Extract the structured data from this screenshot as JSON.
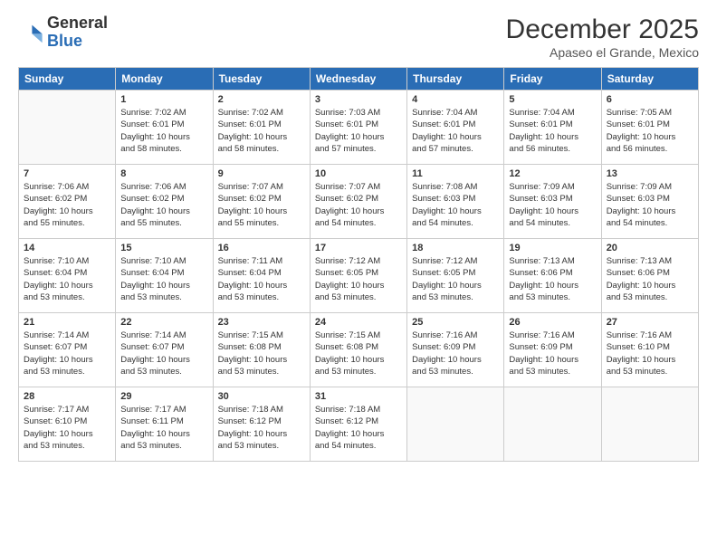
{
  "header": {
    "logo_general": "General",
    "logo_blue": "Blue",
    "month": "December 2025",
    "location": "Apaseo el Grande, Mexico"
  },
  "days_of_week": [
    "Sunday",
    "Monday",
    "Tuesday",
    "Wednesday",
    "Thursday",
    "Friday",
    "Saturday"
  ],
  "weeks": [
    [
      {
        "day": "",
        "info": ""
      },
      {
        "day": "1",
        "info": "Sunrise: 7:02 AM\nSunset: 6:01 PM\nDaylight: 10 hours\nand 58 minutes."
      },
      {
        "day": "2",
        "info": "Sunrise: 7:02 AM\nSunset: 6:01 PM\nDaylight: 10 hours\nand 58 minutes."
      },
      {
        "day": "3",
        "info": "Sunrise: 7:03 AM\nSunset: 6:01 PM\nDaylight: 10 hours\nand 57 minutes."
      },
      {
        "day": "4",
        "info": "Sunrise: 7:04 AM\nSunset: 6:01 PM\nDaylight: 10 hours\nand 57 minutes."
      },
      {
        "day": "5",
        "info": "Sunrise: 7:04 AM\nSunset: 6:01 PM\nDaylight: 10 hours\nand 56 minutes."
      },
      {
        "day": "6",
        "info": "Sunrise: 7:05 AM\nSunset: 6:01 PM\nDaylight: 10 hours\nand 56 minutes."
      }
    ],
    [
      {
        "day": "7",
        "info": "Sunrise: 7:06 AM\nSunset: 6:02 PM\nDaylight: 10 hours\nand 55 minutes."
      },
      {
        "day": "8",
        "info": "Sunrise: 7:06 AM\nSunset: 6:02 PM\nDaylight: 10 hours\nand 55 minutes."
      },
      {
        "day": "9",
        "info": "Sunrise: 7:07 AM\nSunset: 6:02 PM\nDaylight: 10 hours\nand 55 minutes."
      },
      {
        "day": "10",
        "info": "Sunrise: 7:07 AM\nSunset: 6:02 PM\nDaylight: 10 hours\nand 54 minutes."
      },
      {
        "day": "11",
        "info": "Sunrise: 7:08 AM\nSunset: 6:03 PM\nDaylight: 10 hours\nand 54 minutes."
      },
      {
        "day": "12",
        "info": "Sunrise: 7:09 AM\nSunset: 6:03 PM\nDaylight: 10 hours\nand 54 minutes."
      },
      {
        "day": "13",
        "info": "Sunrise: 7:09 AM\nSunset: 6:03 PM\nDaylight: 10 hours\nand 54 minutes."
      }
    ],
    [
      {
        "day": "14",
        "info": "Sunrise: 7:10 AM\nSunset: 6:04 PM\nDaylight: 10 hours\nand 53 minutes."
      },
      {
        "day": "15",
        "info": "Sunrise: 7:10 AM\nSunset: 6:04 PM\nDaylight: 10 hours\nand 53 minutes."
      },
      {
        "day": "16",
        "info": "Sunrise: 7:11 AM\nSunset: 6:04 PM\nDaylight: 10 hours\nand 53 minutes."
      },
      {
        "day": "17",
        "info": "Sunrise: 7:12 AM\nSunset: 6:05 PM\nDaylight: 10 hours\nand 53 minutes."
      },
      {
        "day": "18",
        "info": "Sunrise: 7:12 AM\nSunset: 6:05 PM\nDaylight: 10 hours\nand 53 minutes."
      },
      {
        "day": "19",
        "info": "Sunrise: 7:13 AM\nSunset: 6:06 PM\nDaylight: 10 hours\nand 53 minutes."
      },
      {
        "day": "20",
        "info": "Sunrise: 7:13 AM\nSunset: 6:06 PM\nDaylight: 10 hours\nand 53 minutes."
      }
    ],
    [
      {
        "day": "21",
        "info": "Sunrise: 7:14 AM\nSunset: 6:07 PM\nDaylight: 10 hours\nand 53 minutes."
      },
      {
        "day": "22",
        "info": "Sunrise: 7:14 AM\nSunset: 6:07 PM\nDaylight: 10 hours\nand 53 minutes."
      },
      {
        "day": "23",
        "info": "Sunrise: 7:15 AM\nSunset: 6:08 PM\nDaylight: 10 hours\nand 53 minutes."
      },
      {
        "day": "24",
        "info": "Sunrise: 7:15 AM\nSunset: 6:08 PM\nDaylight: 10 hours\nand 53 minutes."
      },
      {
        "day": "25",
        "info": "Sunrise: 7:16 AM\nSunset: 6:09 PM\nDaylight: 10 hours\nand 53 minutes."
      },
      {
        "day": "26",
        "info": "Sunrise: 7:16 AM\nSunset: 6:09 PM\nDaylight: 10 hours\nand 53 minutes."
      },
      {
        "day": "27",
        "info": "Sunrise: 7:16 AM\nSunset: 6:10 PM\nDaylight: 10 hours\nand 53 minutes."
      }
    ],
    [
      {
        "day": "28",
        "info": "Sunrise: 7:17 AM\nSunset: 6:10 PM\nDaylight: 10 hours\nand 53 minutes."
      },
      {
        "day": "29",
        "info": "Sunrise: 7:17 AM\nSunset: 6:11 PM\nDaylight: 10 hours\nand 53 minutes."
      },
      {
        "day": "30",
        "info": "Sunrise: 7:18 AM\nSunset: 6:12 PM\nDaylight: 10 hours\nand 53 minutes."
      },
      {
        "day": "31",
        "info": "Sunrise: 7:18 AM\nSunset: 6:12 PM\nDaylight: 10 hours\nand 54 minutes."
      },
      {
        "day": "",
        "info": ""
      },
      {
        "day": "",
        "info": ""
      },
      {
        "day": "",
        "info": ""
      }
    ]
  ]
}
